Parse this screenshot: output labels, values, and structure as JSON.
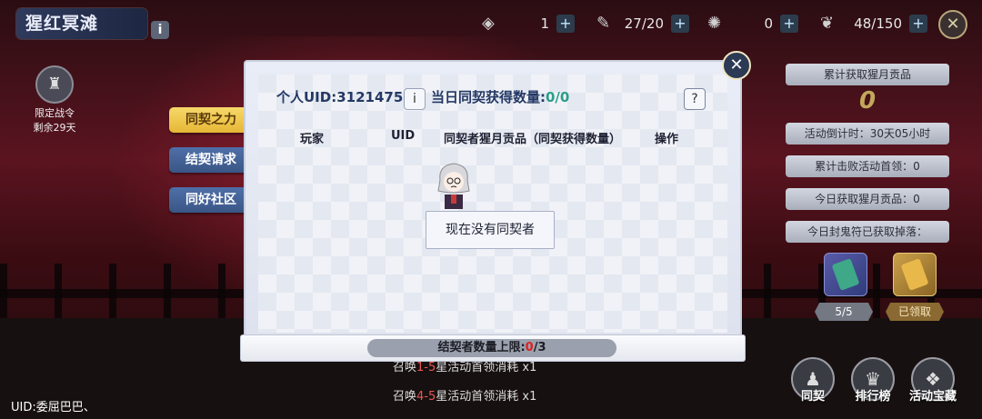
{
  "header": {
    "title": "猩红冥滩",
    "info_icon": "i",
    "resources": [
      {
        "icon": "coin-icon",
        "value": "1"
      },
      {
        "icon": "scroll-icon",
        "value": "27/20"
      },
      {
        "icon": "mask-icon",
        "value": "0"
      },
      {
        "icon": "feather-icon",
        "value": "48/150"
      }
    ],
    "plus": "+",
    "close": "✕"
  },
  "left": {
    "pass_line1": "限定战令",
    "pass_line2": "剩余29天",
    "uid_text": "UID:委屈巴巴、"
  },
  "tabs": [
    {
      "label": "同契之力",
      "active": true
    },
    {
      "label": "结契请求",
      "active": false
    },
    {
      "label": "同好社区",
      "active": false
    }
  ],
  "dialog": {
    "uid": "个人UID:3121475",
    "info": "i",
    "daily_label": "当日同契获得数量:",
    "daily_value": "0/0",
    "help": "?",
    "columns": [
      "玩家",
      "UID",
      "同契者猩月贡品（同契获得数量）",
      "操作"
    ],
    "empty": "现在没有同契者",
    "limit_label": "结契者数量上限:",
    "limit_current": "0",
    "limit_max": "/3",
    "close": "✕"
  },
  "right": {
    "tribute_label": "累计获取猩月贡品",
    "tribute_value": "0",
    "countdown": "活动倒计时：30天05小时",
    "boss_defeats": "累计击败活动首领：0",
    "today_tribute": "今日获取猩月贡品：0",
    "today_drops": "今日封鬼符已获取掉落：",
    "reward1_label": "5/5",
    "reward2_label": "已领取"
  },
  "missions": [
    {
      "text_a": "召唤",
      "n": "1-5",
      "text_b": "星活动首领消耗",
      "cost": "x1"
    },
    {
      "text_a": "召唤",
      "n": "4-5",
      "text_b": "星活动首领消耗",
      "cost": "x1"
    }
  ],
  "bottom_buttons": [
    {
      "label": "同契",
      "icon": "person-icon"
    },
    {
      "label": "排行榜",
      "icon": "trophy-icon"
    },
    {
      "label": "活动宝藏",
      "icon": "chest-icon"
    }
  ]
}
